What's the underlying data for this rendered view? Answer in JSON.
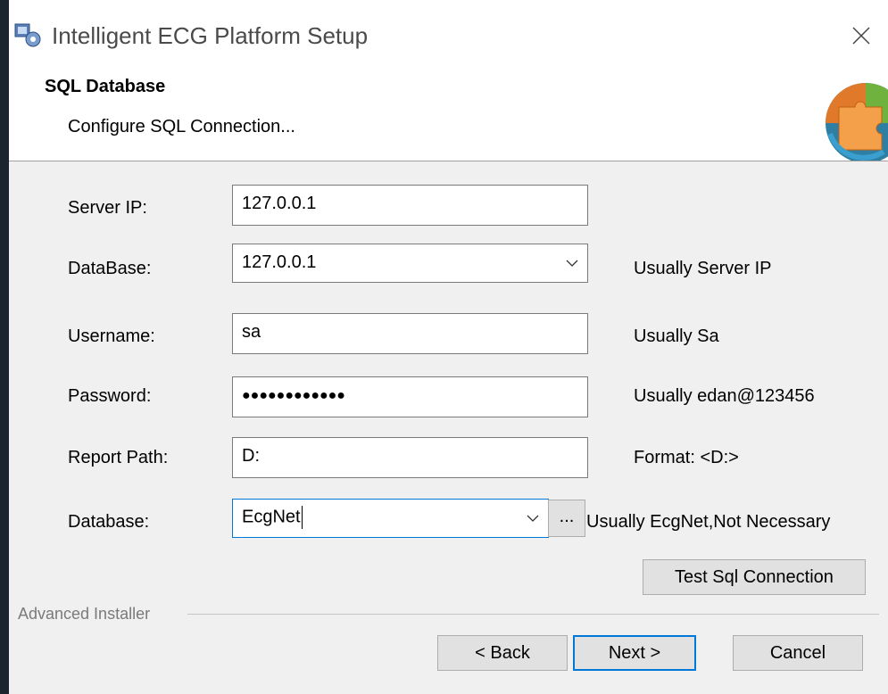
{
  "window": {
    "title": "Intelligent ECG Platform Setup"
  },
  "header": {
    "title": "SQL Database",
    "subtitle": "Configure SQL Connection..."
  },
  "form": {
    "server_ip": {
      "label": "Server IP:",
      "value": "127.0.0.1"
    },
    "database_host": {
      "label": "DataBase:",
      "value": "127.0.0.1",
      "hint": "Usually Server IP"
    },
    "username": {
      "label": "Username:",
      "value": "sa",
      "hint": "Usually Sa"
    },
    "password": {
      "label": "Password:",
      "value": "●●●●●●●●●●●●",
      "hint": "Usually edan@123456"
    },
    "report_path": {
      "label": "Report Path:",
      "value": "D:",
      "hint": "Format: <D:>"
    },
    "database_name": {
      "label": "Database:",
      "value": "EcgNet",
      "browse": "...",
      "hint": "Usually EcgNet,Not Necessary"
    }
  },
  "test_button": "Test Sql Connection",
  "footer": {
    "group_label": "Advanced Installer",
    "back": "< Back",
    "next": "Next >",
    "cancel": "Cancel"
  },
  "colors": {
    "focus": "#0078d7",
    "panel": "#f0f0f0"
  }
}
